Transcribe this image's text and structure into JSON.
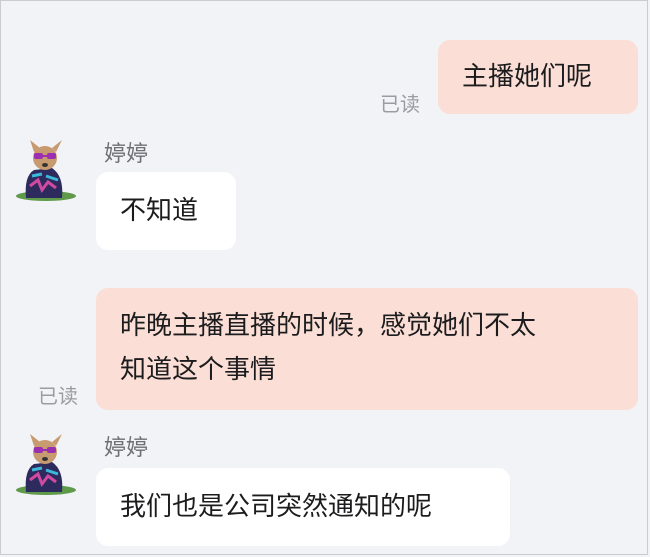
{
  "messages": [
    {
      "direction": "outgoing",
      "text": "主播她们呢",
      "status": "已读"
    },
    {
      "direction": "incoming",
      "sender": "婷婷",
      "text": "不知道"
    },
    {
      "direction": "outgoing",
      "text_line1": "昨晚主播直播的时候，感觉她们不太",
      "text_line2": "知道这个事情",
      "status": "已读"
    },
    {
      "direction": "incoming",
      "sender": "婷婷",
      "text": "我们也是公司突然通知的呢"
    }
  ],
  "colors": {
    "background": "#f2f3f7",
    "outgoing_bubble": "#fbdfd6",
    "incoming_bubble": "#ffffff",
    "read_status": "#9a9ca3"
  },
  "icons": {
    "avatar": "dog-avatar-icon"
  }
}
